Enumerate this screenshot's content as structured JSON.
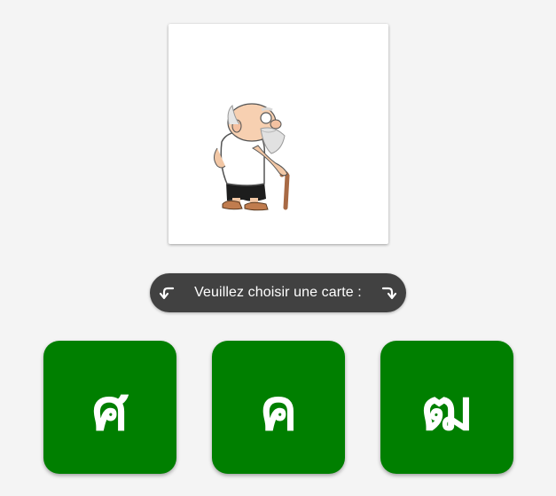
{
  "picture": {
    "icon": "old-man-with-cane-illustration"
  },
  "prompt": {
    "text": "Veuillez choisir une carte :",
    "left_icon": "curved-arrow-left-icon",
    "right_icon": "curved-arrow-right-icon"
  },
  "choices": [
    {
      "label": "ศ"
    },
    {
      "label": "ค"
    },
    {
      "label": "ฒ"
    }
  ],
  "colors": {
    "background": "#f4f4f4",
    "card": "#007f00",
    "pill": "#414141",
    "text_on_dark": "#ffffff"
  }
}
